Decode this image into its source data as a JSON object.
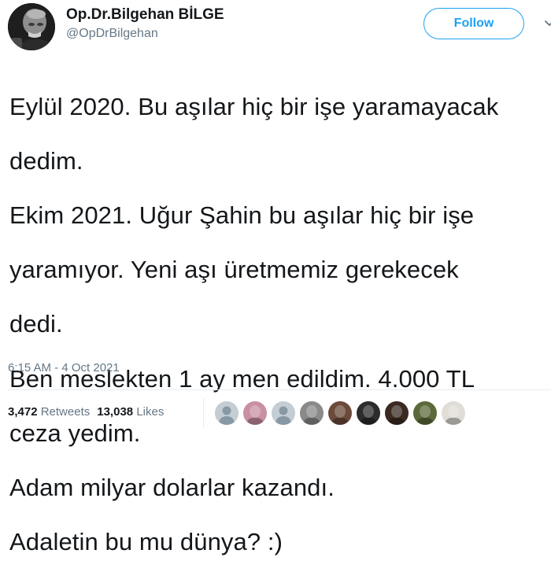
{
  "user": {
    "display_name": "Op.Dr.Bilgehan BİLGE",
    "handle": "@OpDrBilgehan",
    "avatar_icon": "profile-photo"
  },
  "follow_button": {
    "label": "Follow"
  },
  "tweet": {
    "text_lines": [
      "Eylül 2020. Bu aşılar hiç bir işe yaramayacak",
      "dedim.",
      "Ekim 2021. Uğur Şahin bu aşılar hiç bir işe",
      "yaramıyor. Yeni aşı üretmemiz gerekecek",
      "dedi.",
      "Ben meslekten 1 ay men edildim. 4.000 TL",
      "ceza yedim.",
      "Adam milyar dolarlar kazandı.",
      "Adaletin bu mu dünya? :)"
    ],
    "timestamp": "6:15 AM - 4 Oct 2021"
  },
  "stats": {
    "retweets_count": "3,472",
    "retweets_label": "Retweets",
    "likes_count": "13,038",
    "likes_label": "Likes"
  },
  "liker_avatars": [
    {
      "name": "liker-avatar-1",
      "color": "#c4cdd4",
      "style": "default"
    },
    {
      "name": "liker-avatar-2",
      "color": "#c98fa3",
      "style": "photo"
    },
    {
      "name": "liker-avatar-3",
      "color": "#c4cdd4",
      "style": "default"
    },
    {
      "name": "liker-avatar-4",
      "color": "#8a8a8a",
      "style": "photo"
    },
    {
      "name": "liker-avatar-5",
      "color": "#6b4a3a",
      "style": "photo"
    },
    {
      "name": "liker-avatar-6",
      "color": "#2c2c2c",
      "style": "photo"
    },
    {
      "name": "liker-avatar-7",
      "color": "#3a2a22",
      "style": "photo"
    },
    {
      "name": "liker-avatar-8",
      "color": "#5c6a3a",
      "style": "photo"
    },
    {
      "name": "liker-avatar-9",
      "color": "#e0ddd6",
      "style": "photo"
    }
  ],
  "colors": {
    "accent": "#1da1f2",
    "text": "#14171a",
    "secondary": "#657786",
    "divider": "#e6ecf0"
  }
}
